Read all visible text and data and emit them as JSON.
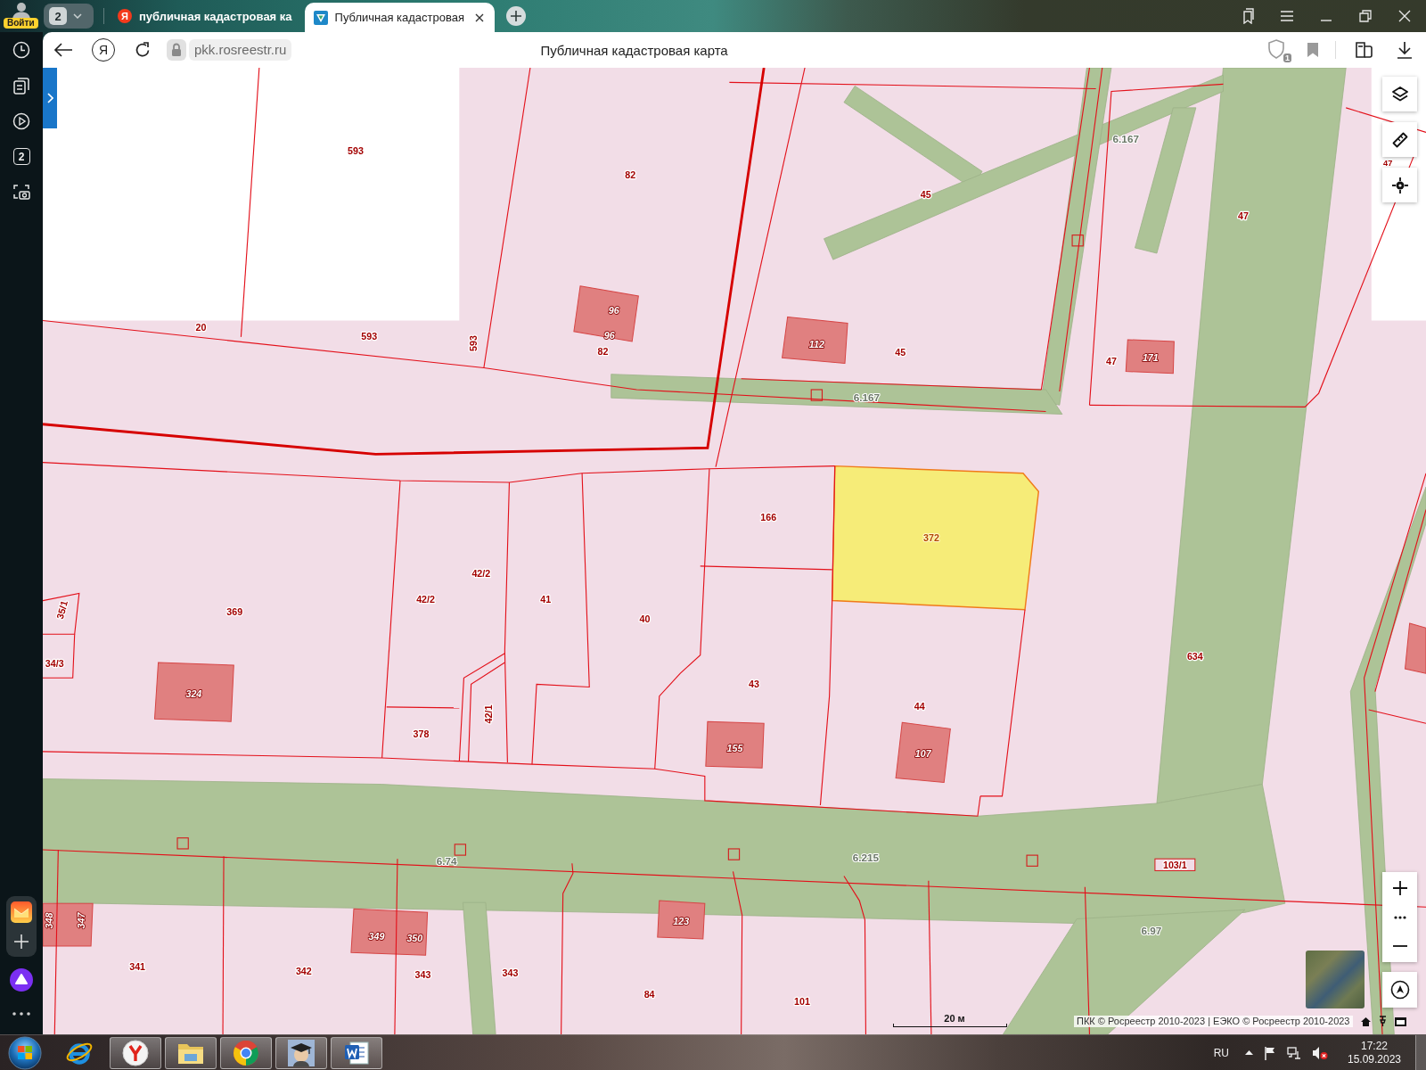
{
  "sidebar": {
    "login_label": "Войти",
    "tab_counter": "2"
  },
  "tab_strip": {
    "group_count": "2",
    "tabs": [
      {
        "title": "публичная кадастровая ка",
        "icon_letter": "Я",
        "selected": false
      },
      {
        "title": "Публичная кадастровая",
        "selected": true
      }
    ]
  },
  "address_bar": {
    "logo_letter": "Я",
    "url": "pkk.rosreestr.ru",
    "page_title": "Публичная кадастровая карта",
    "shield_count": "1"
  },
  "map": {
    "labels": [
      {
        "text": "593",
        "kind": "parcel"
      },
      {
        "text": "82",
        "kind": "parcel"
      },
      {
        "text": "6.167",
        "kind": "zone"
      },
      {
        "text": "47",
        "kind": "parcel"
      },
      {
        "text": "45",
        "kind": "parcel"
      },
      {
        "text": "47",
        "kind": "parcel"
      },
      {
        "text": "96",
        "kind": "building"
      },
      {
        "text": "20",
        "kind": "parcel"
      },
      {
        "text": "96",
        "kind": "building"
      },
      {
        "text": "593",
        "kind": "parcel"
      },
      {
        "text": "593",
        "kind": "parcel"
      },
      {
        "text": "112",
        "kind": "building"
      },
      {
        "text": "82",
        "kind": "parcel"
      },
      {
        "text": "45",
        "kind": "parcel"
      },
      {
        "text": "47",
        "kind": "parcel"
      },
      {
        "text": "171",
        "kind": "building"
      },
      {
        "text": "6.167",
        "kind": "zone"
      },
      {
        "text": "166",
        "kind": "parcel"
      },
      {
        "text": "42/2",
        "kind": "parcel"
      },
      {
        "text": "42/2",
        "kind": "parcel"
      },
      {
        "text": "41",
        "kind": "parcel"
      },
      {
        "text": "369",
        "kind": "parcel"
      },
      {
        "text": "35/1",
        "kind": "parcel"
      },
      {
        "text": "40",
        "kind": "parcel"
      },
      {
        "text": "634",
        "kind": "parcel"
      },
      {
        "text": "34/3",
        "kind": "parcel"
      },
      {
        "text": "43",
        "kind": "parcel"
      },
      {
        "text": "324",
        "kind": "building"
      },
      {
        "text": "44",
        "kind": "parcel"
      },
      {
        "text": "42/1",
        "kind": "parcel"
      },
      {
        "text": "378",
        "kind": "parcel"
      },
      {
        "text": "155",
        "kind": "building"
      },
      {
        "text": "107",
        "kind": "building"
      },
      {
        "text": "6.215",
        "kind": "zone"
      },
      {
        "text": "6.74",
        "kind": "zone"
      },
      {
        "text": "103/1",
        "kind": "boxed"
      },
      {
        "text": "348",
        "kind": "building"
      },
      {
        "text": "347",
        "kind": "building"
      },
      {
        "text": "123",
        "kind": "building"
      },
      {
        "text": "6.97",
        "kind": "zone"
      },
      {
        "text": "349",
        "kind": "building"
      },
      {
        "text": "350",
        "kind": "building"
      },
      {
        "text": "341",
        "kind": "parcel"
      },
      {
        "text": "342",
        "kind": "parcel"
      },
      {
        "text": "343",
        "kind": "parcel"
      },
      {
        "text": "343",
        "kind": "parcel"
      },
      {
        "text": "84",
        "kind": "parcel"
      },
      {
        "text": "101",
        "kind": "parcel"
      }
    ],
    "selected_parcel": {
      "number": "372",
      "selected": true
    },
    "scale_label": "20 м",
    "attribution": "ПКК © Росреестр 2010-2023 | ЕЭКО © Росреестр 2010-2023"
  },
  "taskbar": {
    "language": "RU",
    "time": "17:22",
    "date": "15.09.2023"
  }
}
